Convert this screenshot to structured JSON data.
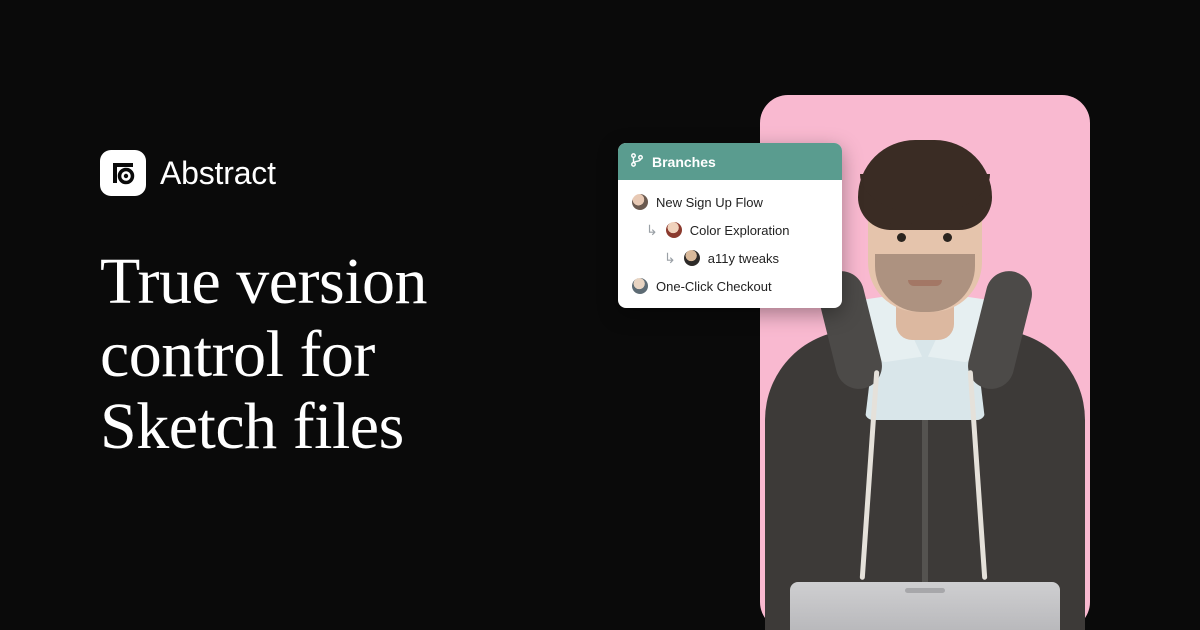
{
  "brand": {
    "name": "Abstract"
  },
  "headline": {
    "line1": "True version",
    "line2": "control for",
    "line3": "Sketch files"
  },
  "branches": {
    "title": "Branches",
    "items": [
      {
        "label": "New Sign Up Flow",
        "depth": 0
      },
      {
        "label": "Color Exploration",
        "depth": 1
      },
      {
        "label": "a11y tweaks",
        "depth": 2
      },
      {
        "label": "One-Click Checkout",
        "depth": 0
      }
    ]
  },
  "colors": {
    "background": "#0a0a0a",
    "pink_card": "#f9b9d0",
    "branches_header": "#5a9c8f"
  }
}
